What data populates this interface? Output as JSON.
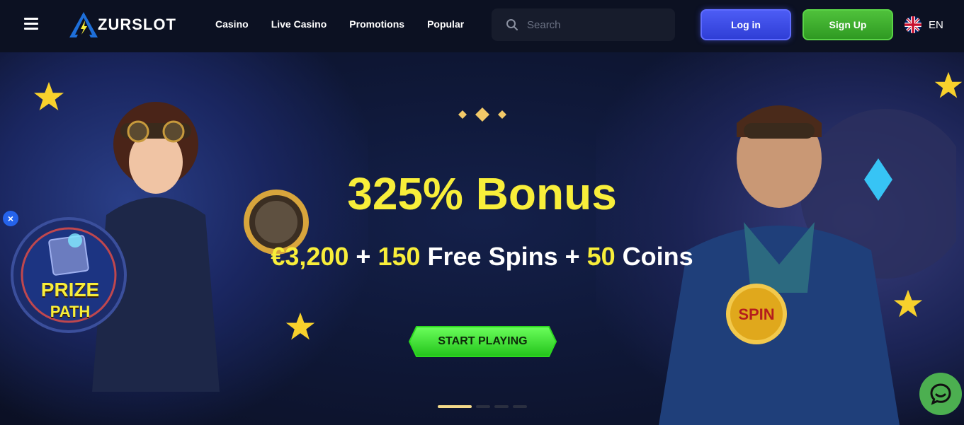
{
  "header": {
    "logo_text": "ZURSLOT",
    "nav": [
      "Casino",
      "Live Casino",
      "Promotions",
      "Popular"
    ],
    "search_placeholder": "Search",
    "login_label": "Log in",
    "signup_label": "Sign Up",
    "language": "EN"
  },
  "hero": {
    "title": "325% Bonus",
    "subtitle": {
      "amount": "€3,200",
      "plus1": " + ",
      "spins_count": "150",
      "spins_text": " Free Spins + ",
      "coins_count": "50",
      "coins_text": " Coins"
    },
    "cta_label": "START PLAYING",
    "slides_total": 4,
    "active_slide": 1
  },
  "prize_path": {
    "line1": "PRIZE",
    "line2": "PATH",
    "close_label": "×"
  },
  "colors": {
    "accent_yellow": "#f8ee3a",
    "login_blue": "#3b4be8",
    "signup_green": "#3fae2e",
    "chat_green": "#4caf50"
  },
  "icons": [
    "menu-icon",
    "search-icon",
    "uk-flag-icon",
    "chat-icon",
    "close-icon"
  ]
}
